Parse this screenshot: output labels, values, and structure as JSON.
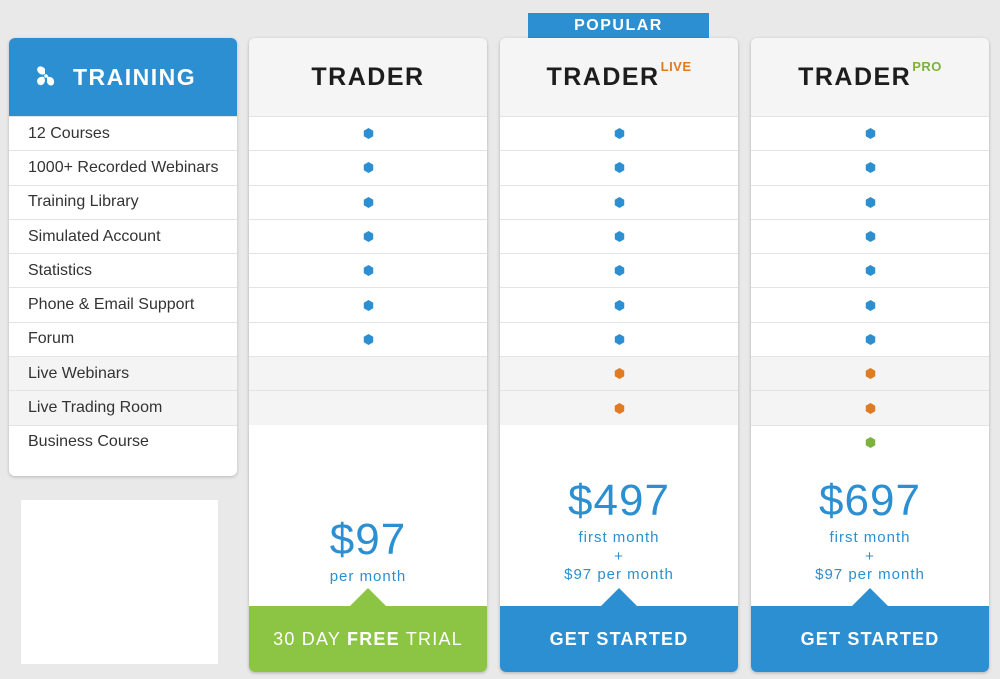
{
  "colors": {
    "blue": "#2c8fd1",
    "orange": "#e07b22",
    "green": "#7bb33c",
    "cta_green": "#8cc443"
  },
  "features": {
    "title": "TRAINING",
    "icon": "butterfly-icon",
    "items": [
      "12 Courses",
      "1000+ Recorded Webinars",
      "Training Library",
      "Simulated Account",
      "Statistics",
      "Phone & Email Support",
      "Forum",
      "Live Webinars",
      "Live Trading Room",
      "Business Course"
    ]
  },
  "popular_badge": "POPULAR",
  "plans": [
    {
      "name": "TRADER",
      "suffix": "",
      "price": "$97",
      "price_lines": [
        "per month"
      ],
      "cta_parts": [
        "30 DAY",
        "FREE",
        "TRIAL"
      ],
      "features": [
        "blue",
        "blue",
        "blue",
        "blue",
        "blue",
        "blue",
        "blue",
        "none",
        "none"
      ]
    },
    {
      "name": "TRADER",
      "suffix": "LIVE",
      "price": "$497",
      "price_lines": [
        "first month",
        "+",
        "$97 per month"
      ],
      "cta": "GET STARTED",
      "features": [
        "blue",
        "blue",
        "blue",
        "blue",
        "blue",
        "blue",
        "blue",
        "orange",
        "orange"
      ]
    },
    {
      "name": "TRADER",
      "suffix": "PRO",
      "price": "$697",
      "price_lines": [
        "first month",
        "+",
        "$97 per month"
      ],
      "cta": "GET STARTED",
      "features": [
        "blue",
        "blue",
        "blue",
        "blue",
        "blue",
        "blue",
        "blue",
        "orange",
        "orange",
        "green"
      ]
    }
  ]
}
